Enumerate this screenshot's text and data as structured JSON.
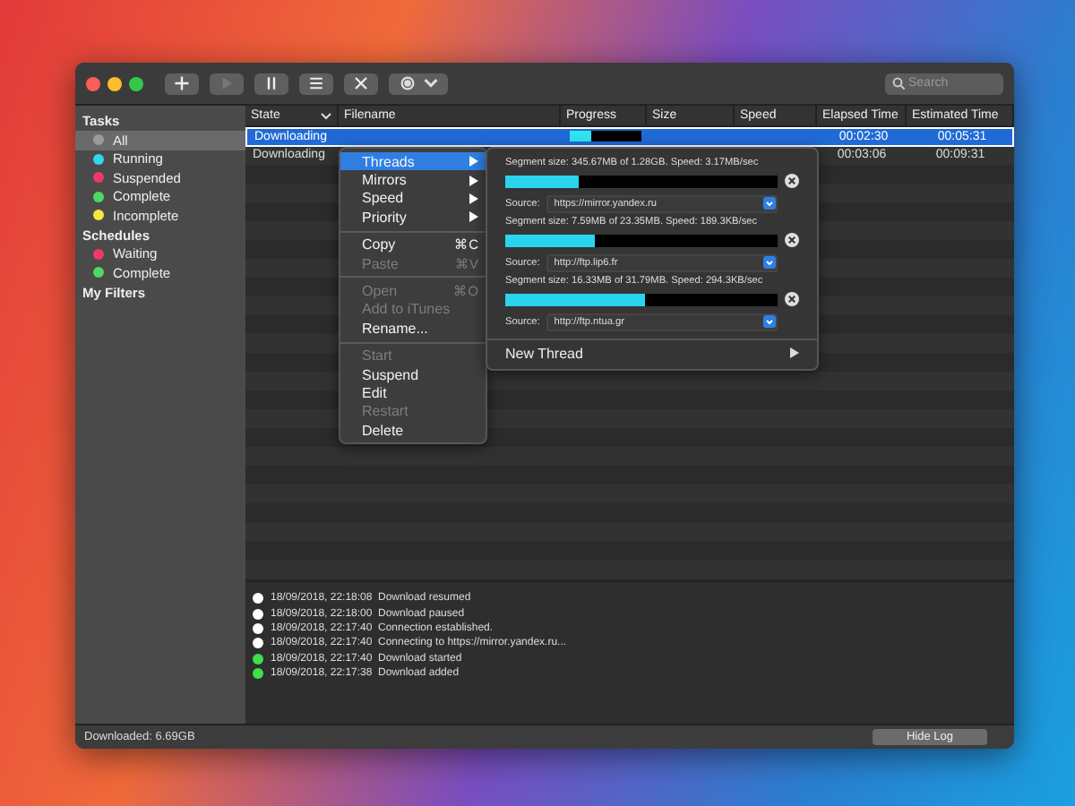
{
  "toolbar": {
    "search": {
      "placeholder": "Search"
    }
  },
  "sidebar": {
    "sections": [
      {
        "title": "Tasks",
        "items": [
          {
            "label": "All",
            "color": "#9a9a9a",
            "selected": true
          },
          {
            "label": "Running",
            "color": "#33d6f0",
            "selected": false
          },
          {
            "label": "Suspended",
            "color": "#f0386a",
            "selected": false
          },
          {
            "label": "Complete",
            "color": "#4cd964",
            "selected": false
          },
          {
            "label": "Incomplete",
            "color": "#f5e642",
            "selected": false
          }
        ]
      },
      {
        "title": "Schedules",
        "items": [
          {
            "label": "Waiting",
            "color": "#f0386a",
            "selected": false
          },
          {
            "label": "Complete",
            "color": "#4cd964",
            "selected": false
          }
        ]
      },
      {
        "title": "My Filters"
      }
    ]
  },
  "table": {
    "columns": [
      {
        "label": "State",
        "sorted": true
      },
      {
        "label": "Filename",
        "sorted": false
      },
      {
        "label": "Progress",
        "sorted": false
      },
      {
        "label": "Size",
        "sorted": false
      },
      {
        "label": "Speed",
        "sorted": false
      },
      {
        "label": "Elapsed Time",
        "sorted": false
      },
      {
        "label": "Estimated Time",
        "sorted": false
      }
    ],
    "rows": [
      {
        "state": "Downloading",
        "level": 0.3,
        "elapsed": "00:02:30",
        "estimated": "00:05:31",
        "selected": true
      },
      {
        "state": "Downloading",
        "elapsed": "00:03:06",
        "estimated": "00:09:31",
        "selected": false
      }
    ]
  },
  "context_menu": {
    "groups": [
      [
        {
          "label": "Threads",
          "submenu": true,
          "disabled": false,
          "selected": true
        },
        {
          "label": "Mirrors",
          "submenu": true,
          "disabled": false,
          "selected": false
        },
        {
          "label": "Speed",
          "submenu": true,
          "disabled": false,
          "selected": false
        },
        {
          "label": "Priority",
          "submenu": true,
          "disabled": false,
          "selected": false
        }
      ],
      [
        {
          "label": "Copy",
          "shortcut": "⌘C",
          "disabled": false,
          "selected": false
        },
        {
          "label": "Paste",
          "shortcut": "⌘V",
          "disabled": true,
          "selected": false
        }
      ],
      [
        {
          "label": "Open",
          "shortcut": "⌘O",
          "disabled": true,
          "selected": false
        },
        {
          "label": "Add to iTunes",
          "disabled": true,
          "selected": false
        },
        {
          "label": "Rename...",
          "disabled": false,
          "selected": false
        }
      ],
      [
        {
          "label": "Start",
          "disabled": true,
          "selected": false
        },
        {
          "label": "Suspend",
          "disabled": false,
          "selected": false
        },
        {
          "label": "Edit",
          "disabled": false,
          "selected": false
        },
        {
          "label": "Restart",
          "disabled": true,
          "selected": false
        },
        {
          "label": "Delete",
          "disabled": false,
          "selected": false
        }
      ]
    ]
  },
  "threads_panel": {
    "segments": [
      {
        "info": "Segment size: 345.67MB of 1.28GB. Speed: 3.17MB/sec",
        "level": 0.27,
        "source_label": "Source:",
        "source": "https://mirror.yandex.ru"
      },
      {
        "info": "Segment size: 7.59MB of 23.35MB. Speed: 189.3KB/sec",
        "level": 0.33,
        "source_label": "Source:",
        "source": "http://ftp.lip6.fr"
      },
      {
        "info": "Segment size: 16.33MB of 31.79MB. Speed: 294.3KB/sec",
        "level": 0.51,
        "source_label": "Source:",
        "source": "http://ftp.ntua.gr"
      }
    ],
    "new_thread": "New Thread"
  },
  "log": [
    {
      "time": "18/09/2018, 22:18:08",
      "message": "Download resumed",
      "color": "#ffffff"
    },
    {
      "time": "18/09/2018, 22:18:00",
      "message": "Download paused",
      "color": "#ffffff"
    },
    {
      "time": "18/09/2018, 22:17:40",
      "message": "Connection established.",
      "color": "#ffffff"
    },
    {
      "time": "18/09/2018, 22:17:40",
      "message": "Connecting to https://mirror.yandex.ru...",
      "color": "#ffffff"
    },
    {
      "time": "18/09/2018, 22:17:40",
      "message": "Download started",
      "color": "#3ee04c"
    },
    {
      "time": "18/09/2018, 22:17:38",
      "message": "Download added",
      "color": "#3ee04c"
    }
  ],
  "status_bar": {
    "downloaded": "Downloaded: 6.69GB",
    "hide_log": "Hide Log"
  }
}
